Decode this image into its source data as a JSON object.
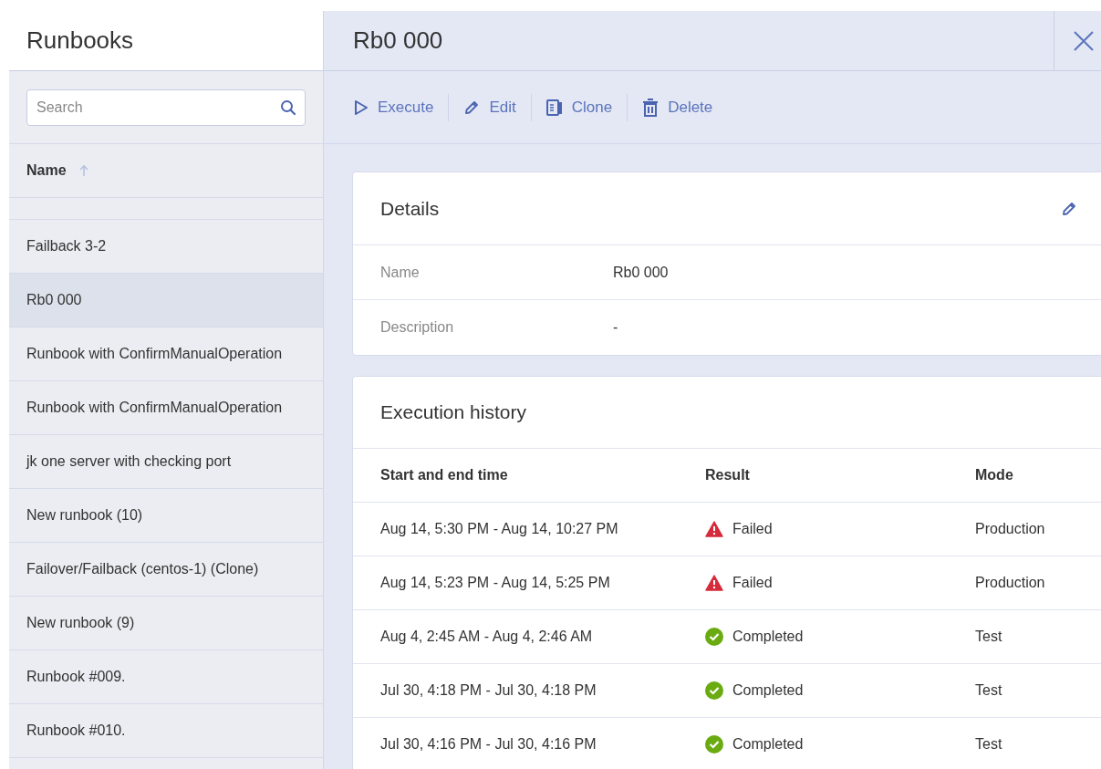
{
  "sidebar": {
    "title": "Runbooks",
    "search": {
      "placeholder": "Search"
    },
    "column": "Name",
    "items": [
      {
        "label": "Failback 3-2",
        "selected": false
      },
      {
        "label": "Rb0 000",
        "selected": true
      },
      {
        "label": "Runbook with ConfirmManualOperation",
        "selected": false
      },
      {
        "label": "Runbook with ConfirmManualOperation",
        "selected": false
      },
      {
        "label": "jk one server with checking port",
        "selected": false
      },
      {
        "label": "New runbook (10)",
        "selected": false
      },
      {
        "label": "Failover/Failback (centos-1) (Clone)",
        "selected": false
      },
      {
        "label": "New runbook (9)",
        "selected": false
      },
      {
        "label": "Runbook #009.",
        "selected": false
      },
      {
        "label": "Runbook #010.",
        "selected": false
      }
    ]
  },
  "detail": {
    "title": "Rb0 000",
    "toolbar": [
      {
        "kind": "execute",
        "label": "Execute"
      },
      {
        "kind": "edit",
        "label": "Edit"
      },
      {
        "kind": "clone",
        "label": "Clone"
      },
      {
        "kind": "delete",
        "label": "Delete"
      }
    ],
    "details": {
      "title": "Details",
      "fields": [
        {
          "label": "Name",
          "value": "Rb0 000"
        },
        {
          "label": "Description",
          "value": "-"
        }
      ]
    },
    "history": {
      "title": "Execution history",
      "columns": [
        "Start and end time",
        "Result",
        "Mode"
      ],
      "rows": [
        {
          "time": "Aug 14, 5:30 PM - Aug 14, 10:27 PM",
          "kind": "failed",
          "result": "Failed",
          "mode": "Production"
        },
        {
          "time": "Aug 14, 5:23 PM - Aug 14, 5:25 PM",
          "kind": "failed",
          "result": "Failed",
          "mode": "Production"
        },
        {
          "time": "Aug 4, 2:45 AM - Aug 4, 2:46 AM",
          "kind": "completed",
          "result": "Completed",
          "mode": "Test"
        },
        {
          "time": "Jul 30, 4:18 PM - Jul 30, 4:18 PM",
          "kind": "completed",
          "result": "Completed",
          "mode": "Test"
        },
        {
          "time": "Jul 30, 4:16 PM - Jul 30, 4:16 PM",
          "kind": "completed",
          "result": "Completed",
          "mode": "Test"
        }
      ]
    }
  }
}
